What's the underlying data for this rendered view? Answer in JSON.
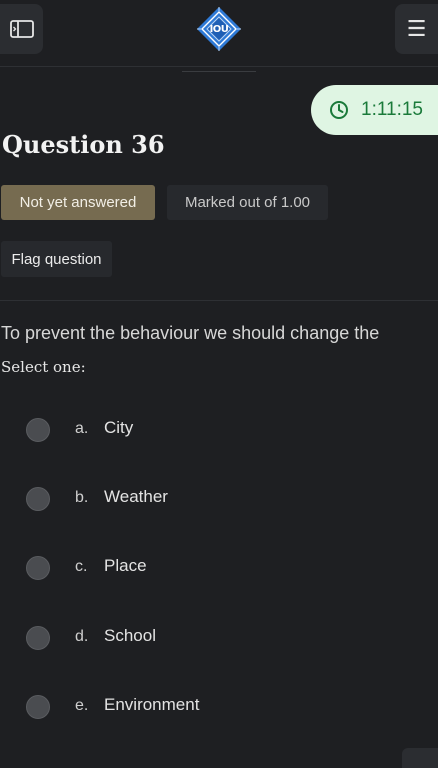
{
  "header": {
    "logo_text": "IOU",
    "sidebar_toggle_icon": "sidebar-toggle-icon",
    "menu_icon": "hamburger-menu-icon",
    "menu_glyph": "☰"
  },
  "timer": {
    "value": "1:11:15",
    "icon": "clock-icon",
    "color": "#1a7a3a",
    "background": "#dff5e3"
  },
  "question": {
    "title": "Question 36",
    "status": "Not yet answered",
    "marks": "Marked out of 1.00",
    "flag_label": "Flag question",
    "text": "To prevent the behaviour we should change the",
    "prompt": "Select one:",
    "options": [
      {
        "letter": "a.",
        "label": "City"
      },
      {
        "letter": "b.",
        "label": "Weather"
      },
      {
        "letter": "c.",
        "label": "Place"
      },
      {
        "letter": "d.",
        "label": "School"
      },
      {
        "letter": "e.",
        "label": "Environment"
      }
    ]
  },
  "colors": {
    "background": "#1e1f22",
    "status_badge": "#766b50",
    "secondary_badge": "#27292d"
  }
}
